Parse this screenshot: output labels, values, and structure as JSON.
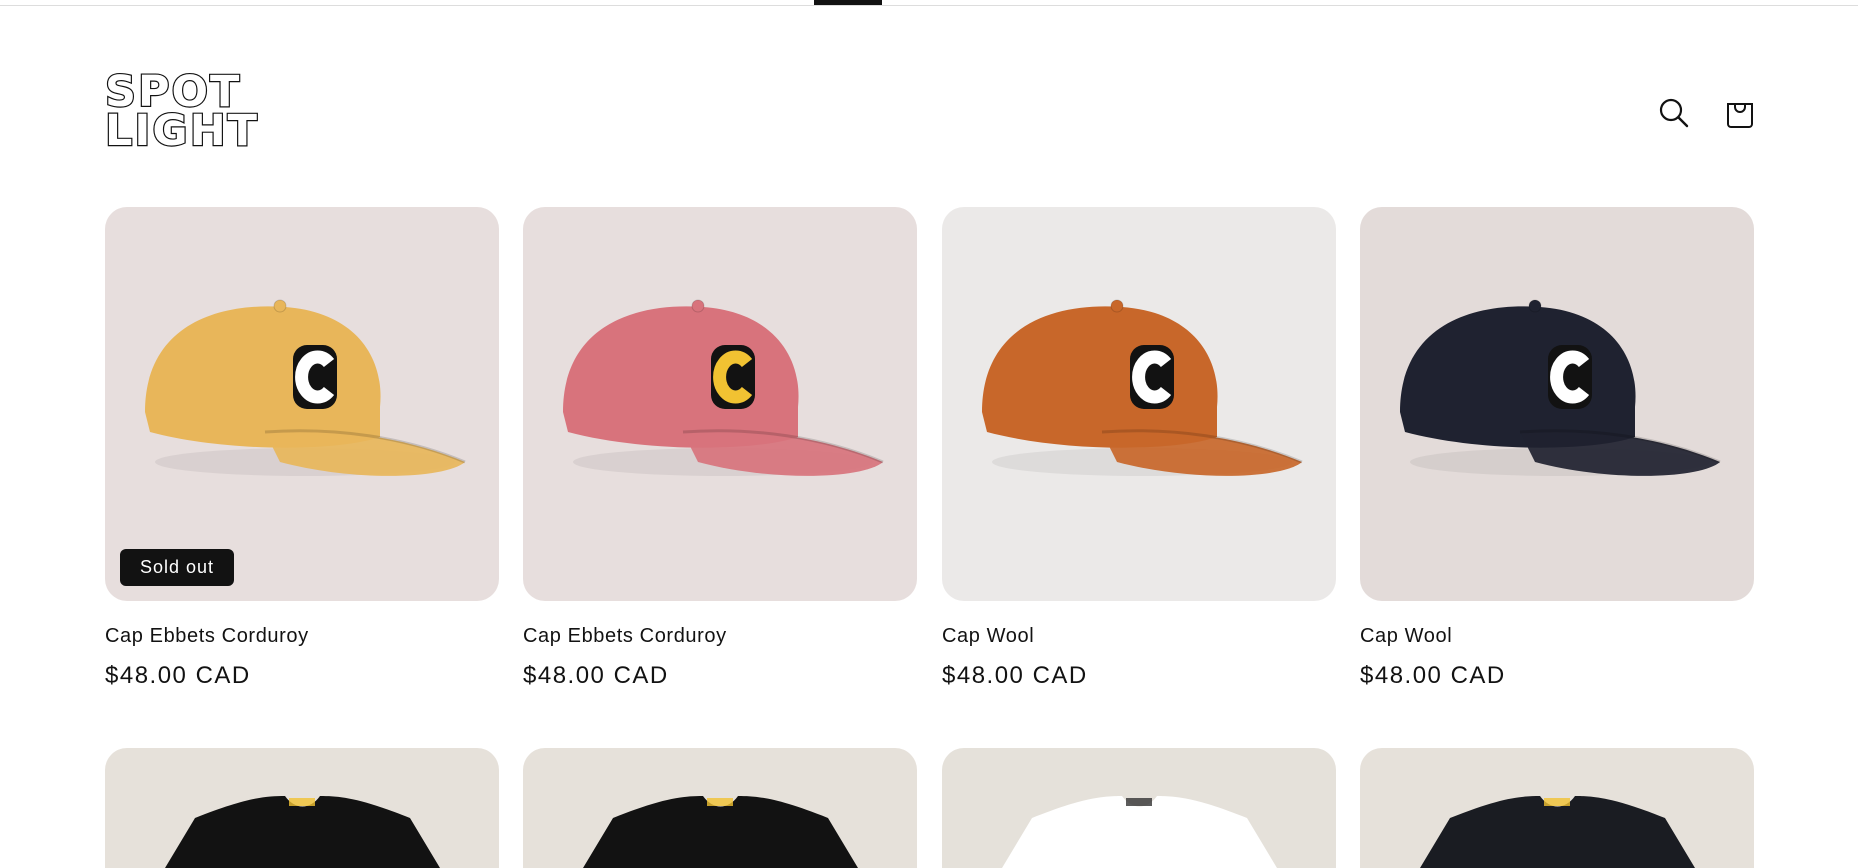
{
  "header": {
    "logo_line1": "SPOT",
    "logo_line2": "LIGHT",
    "search_icon": "search-icon",
    "cart_icon": "cart-icon"
  },
  "products": [
    {
      "title": "Cap Ebbets Corduroy",
      "price": "$48.00 CAD",
      "badge": "Sold out",
      "cap_color": "#e8b65a",
      "background": "#e7dedd",
      "letter_fill": "#ffffff"
    },
    {
      "title": "Cap Ebbets Corduroy",
      "price": "$48.00 CAD",
      "badge": "",
      "cap_color": "#d8737c",
      "background": "#e7dedd",
      "letter_fill": "#f1c232"
    },
    {
      "title": "Cap Wool",
      "price": "$48.00 CAD",
      "badge": "",
      "cap_color": "#c8672a",
      "background": "#ebe9e8",
      "letter_fill": "#ffffff"
    },
    {
      "title": "Cap Wool",
      "price": "$48.00 CAD",
      "badge": "",
      "cap_color": "#1f2230",
      "background": "#e3dbd9",
      "letter_fill": "#ffffff"
    }
  ],
  "row2_products": [
    {
      "background": "#e6e1da",
      "shirt_color": "#121212"
    },
    {
      "background": "#e6e1da",
      "shirt_color": "#121212"
    },
    {
      "background": "#e5e1da",
      "shirt_color": "#ffffff"
    },
    {
      "background": "#e6e1da",
      "shirt_color": "#1a1c22"
    }
  ],
  "colors": {
    "text": "#121212",
    "badge_bg": "#121212",
    "badge_text": "#ffffff"
  }
}
